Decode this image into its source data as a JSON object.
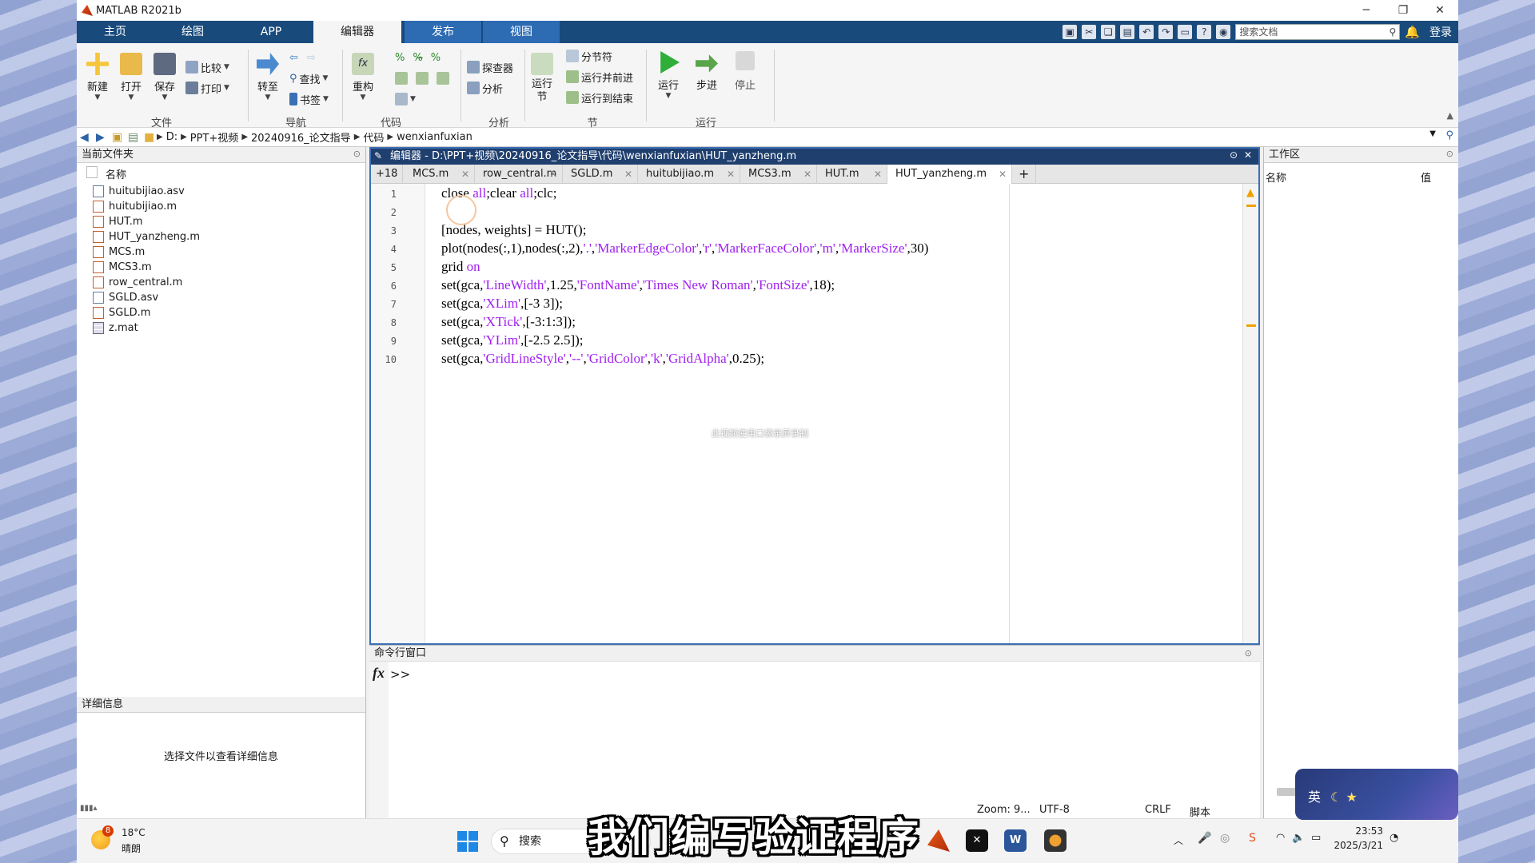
{
  "window": {
    "title": "MATLAB R2021b"
  },
  "ribbon_tabs": [
    "主页",
    "绘图",
    "APP",
    "编辑器",
    "发布",
    "视图"
  ],
  "doc_search": {
    "placeholder": "搜索文档"
  },
  "login": "登录",
  "ribbon": {
    "file": {
      "new": "新建",
      "open": "打开",
      "save": "保存",
      "compare": "比较",
      "print": "打印",
      "group": "文件"
    },
    "nav": {
      "goto": "转至",
      "find": "查找",
      "bookmark": "书签",
      "group": "导航"
    },
    "code": {
      "refactor": "重构",
      "group": "代码"
    },
    "analysis": {
      "profiler": "探查器",
      "analyze": "分析",
      "group": "分析"
    },
    "section": {
      "run_section": "运行\n节",
      "section_break": "分节符",
      "run_advance": "运行并前进",
      "run_to_end": "运行到结束",
      "group": "节"
    },
    "run": {
      "run": "运行",
      "step": "步进",
      "stop": "停止",
      "group": "运行"
    }
  },
  "path": [
    "D:",
    "PPT+视频",
    "20240916_论文指导",
    "代码",
    "wenxianfuxian"
  ],
  "left_panel": {
    "title": "当前文件夹",
    "column": "名称",
    "files": [
      {
        "name": "huitubijiao.asv",
        "type": "asv"
      },
      {
        "name": "huitubijiao.m",
        "type": "m"
      },
      {
        "name": "HUT.m",
        "type": "m"
      },
      {
        "name": "HUT_yanzheng.m",
        "type": "m"
      },
      {
        "name": "MCS.m",
        "type": "m"
      },
      {
        "name": "MCS3.m",
        "type": "m"
      },
      {
        "name": "row_central.m",
        "type": "m"
      },
      {
        "name": "SGLD.asv",
        "type": "asv"
      },
      {
        "name": "SGLD.m",
        "type": "m"
      },
      {
        "name": "z.mat",
        "type": "mat"
      }
    ],
    "details_title": "详细信息",
    "details_hint": "选择文件以查看详细信息"
  },
  "editor": {
    "title": "编辑器 - D:\\PPT+视频\\20240916_论文指导\\代码\\wenxianfuxian\\HUT_yanzheng.m",
    "more_tabs": "+18",
    "tabs": [
      "MCS.m",
      "row_central.m",
      "SGLD.m",
      "huitubijiao.m",
      "MCS3.m",
      "HUT.m",
      "HUT_yanzheng.m"
    ],
    "active_tab": "HUT_yanzheng.m",
    "lines": [
      "1",
      "2",
      "3",
      "4",
      "5",
      "6",
      "7",
      "8",
      "9",
      "10"
    ]
  },
  "command_window": {
    "title": "命令行窗口",
    "prompt": ">>",
    "fx": "fx"
  },
  "workspace": {
    "title": "工作区",
    "col_name": "名称",
    "col_value": "值"
  },
  "status": {
    "zoom": "Zoom: 9...",
    "encoding": "UTF-8",
    "eol": "CRLF",
    "type": "脚本"
  },
  "overlay": {
    "watermark": "此视频使用口袋录屏录制",
    "subtitle": "我们编写验证程序"
  },
  "ime": "英",
  "taskbar": {
    "weather_temp": "18°C",
    "weather_desc": "晴朗",
    "badge": "8",
    "search": "搜索",
    "time": "23:53",
    "date": "2025/3/21"
  }
}
